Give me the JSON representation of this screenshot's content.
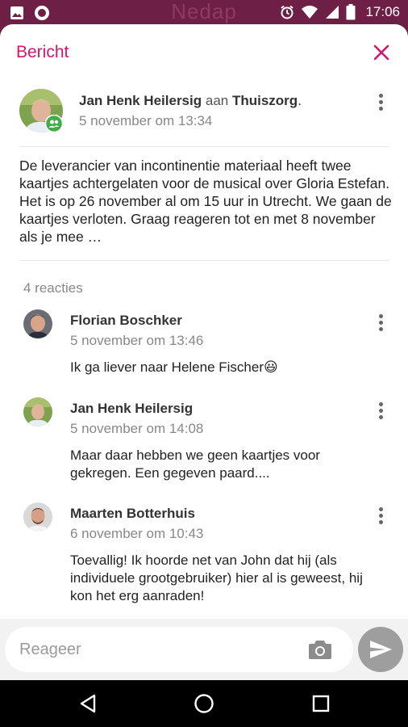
{
  "status_bar": {
    "brand": "Nedap",
    "time": "17:06",
    "icons": [
      "image-icon",
      "record-icon",
      "alarm-icon",
      "wifi-icon",
      "signal-icon",
      "battery-icon"
    ]
  },
  "header": {
    "title": "Bericht",
    "close_icon": "close-icon"
  },
  "post": {
    "author": "Jan Henk Heilersig",
    "to_word": "aan",
    "recipient": "Thuiszorg",
    "period": ".",
    "date": "5 november om 13:34",
    "body": "De leverancier van incontinentie materiaal heeft twee kaartjes achtergelaten voor de musical over Gloria Estefan. Het is op 26 november al om 15 uur in Utrecht. We gaan de kaartjes verloten. Graag reageren tot en met 8 november als je mee …"
  },
  "reactions": {
    "count_label": "4 reacties",
    "items": [
      {
        "name": "Florian Boschker",
        "date": "5 november om 13:46",
        "text": "Ik ga liever naar Helene Fischer😃"
      },
      {
        "name": "Jan Henk Heilersig",
        "date": "5 november om 14:08",
        "text": "Maar daar hebben we geen kaartjes voor gekregen. Een gegeven paard...."
      },
      {
        "name": "Maarten Botterhuis",
        "date": "6 november om 10:43",
        "text": "Toevallig! Ik hoorde net van John dat hij (als individuele grootgebruiker) hier al is geweest, hij kon het erg aanraden!"
      }
    ]
  },
  "composer": {
    "placeholder": "Reageer"
  },
  "colors": {
    "accent": "#d2156f",
    "status_bar": "#6e1f45",
    "group_badge": "#3fae49",
    "send_button": "#9e9e9e"
  }
}
